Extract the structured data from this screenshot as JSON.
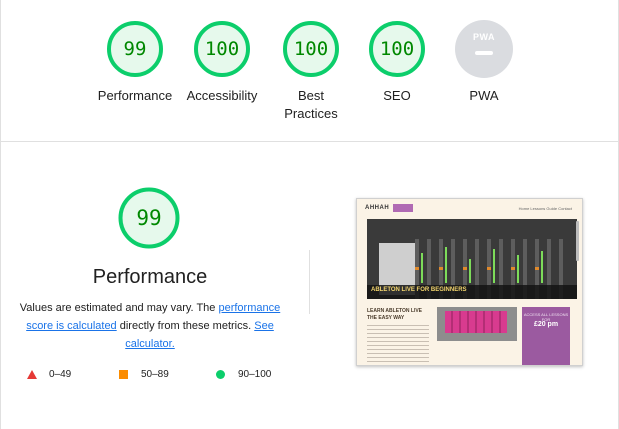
{
  "summary": {
    "gauges": [
      {
        "label": "Performance",
        "score": "99",
        "pct": 99
      },
      {
        "label": "Accessibility",
        "score": "100",
        "pct": 100
      },
      {
        "label": "Best Practices",
        "score": "100",
        "pct": 100
      },
      {
        "label": "SEO",
        "score": "100",
        "pct": 100
      }
    ],
    "pwa": {
      "label": "PWA",
      "badge": "PWA"
    }
  },
  "performance": {
    "score": "99",
    "pct": 99,
    "title": "Performance",
    "desc_prefix": "Values are estimated and may vary. The ",
    "link_calc": "performance score is calculated",
    "desc_middle": " directly from these metrics. ",
    "link_see": "See calculator."
  },
  "legend": {
    "fail": "0–49",
    "average": "50–89",
    "pass": "90–100"
  },
  "screenshot": {
    "logo": "AHHAH",
    "nav": "Home  Lessons  Guide  Contact",
    "hero_title": "ABLETON LIVE FOR BEGINNERS",
    "subheading": "LEARN ABLETON LIVE THE EASY WAY",
    "promo_label": "ACCESS ALL LESSONS FOR",
    "promo_price": "£20 pm"
  },
  "colors": {
    "pass": "#0cce6b",
    "pass_fill": "#e6f9ec",
    "pass_text": "#008800",
    "average": "#fb8c00",
    "fail": "#e53935",
    "link": "#1a73e8",
    "pwa_gray": "#dadce0"
  }
}
